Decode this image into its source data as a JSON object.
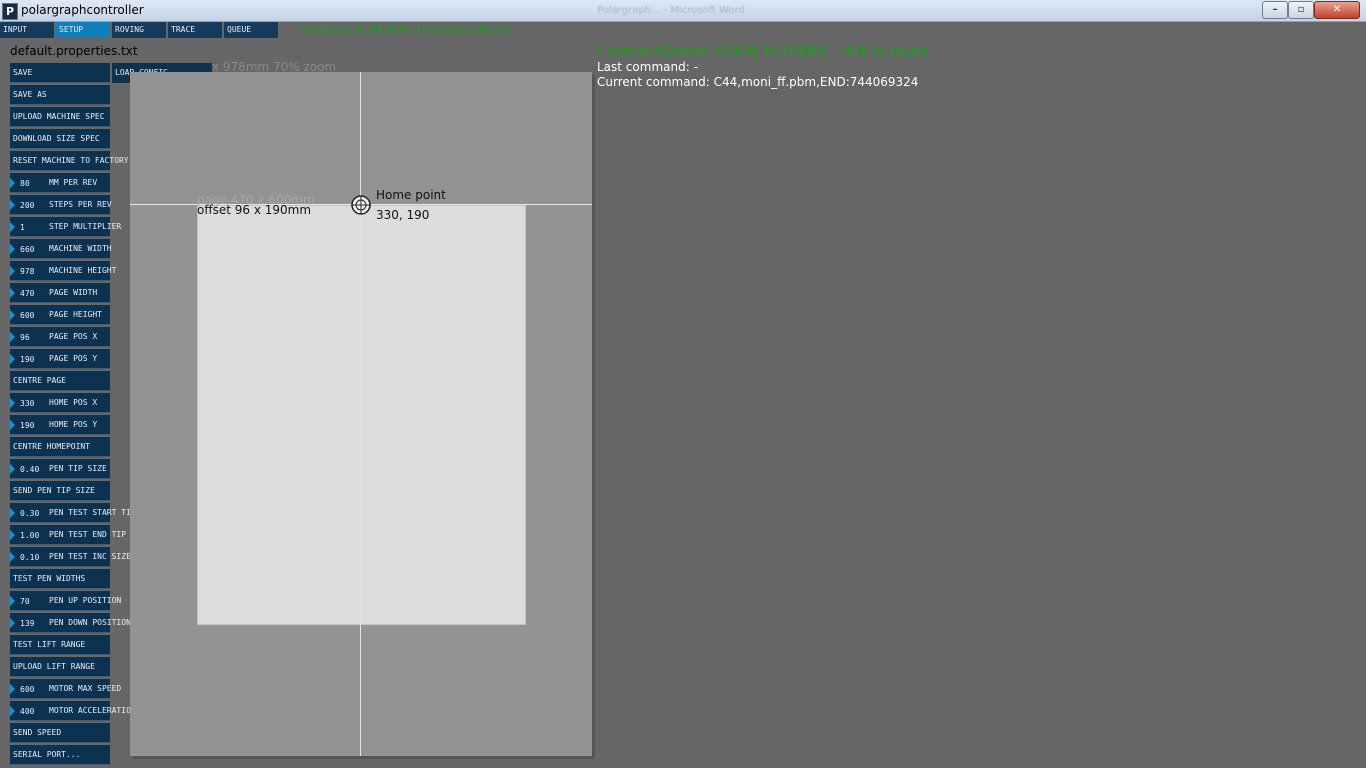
{
  "window": {
    "title": "polargraphcontroller",
    "icon_letter": "P",
    "background_title": "Polargraph... - Microsoft Word"
  },
  "tabs": [
    {
      "label": "INPUT",
      "active": false
    },
    {
      "label": "SETUP",
      "active": true
    },
    {
      "label": "ROVING",
      "active": false
    },
    {
      "label": "TRACE",
      "active": false
    },
    {
      "label": "QUEUE",
      "active": false
    }
  ],
  "status": {
    "ready": "Polargraph READY! (PolargraphSD)"
  },
  "panel": {
    "filename": "default.properties.txt",
    "load_config": "LOAD CONFIG",
    "controls": [
      {
        "type": "button",
        "label": "SAVE"
      },
      {
        "type": "button",
        "label": "SAVE AS"
      },
      {
        "type": "button",
        "label": "UPLOAD MACHINE SPEC"
      },
      {
        "type": "button",
        "label": "DOWNLOAD SIZE SPEC"
      },
      {
        "type": "button",
        "label": "RESET MACHINE TO FACTORY"
      },
      {
        "type": "number",
        "value": "80",
        "label": "MM PER REV"
      },
      {
        "type": "number",
        "value": "200",
        "label": "STEPS PER REV"
      },
      {
        "type": "number",
        "value": "1",
        "label": "STEP MULTIPLIER"
      },
      {
        "type": "number",
        "value": "660",
        "label": "MACHINE WIDTH"
      },
      {
        "type": "number",
        "value": "978",
        "label": "MACHINE HEIGHT"
      },
      {
        "type": "number",
        "value": "470",
        "label": "PAGE WIDTH"
      },
      {
        "type": "number",
        "value": "600",
        "label": "PAGE HEIGHT"
      },
      {
        "type": "number",
        "value": "96",
        "label": "PAGE POS X"
      },
      {
        "type": "number",
        "value": "190",
        "label": "PAGE POS Y"
      },
      {
        "type": "button",
        "label": "CENTRE PAGE"
      },
      {
        "type": "number",
        "value": "330",
        "label": "HOME POS X"
      },
      {
        "type": "number",
        "value": "190",
        "label": "HOME POS Y"
      },
      {
        "type": "button",
        "label": "CENTRE HOMEPOINT"
      },
      {
        "type": "number",
        "value": "0.40",
        "label": "PEN TIP SIZE"
      },
      {
        "type": "button",
        "label": "SEND PEN TIP SIZE"
      },
      {
        "type": "number",
        "value": "0.30",
        "label": "PEN TEST START TIP"
      },
      {
        "type": "number",
        "value": "1.00",
        "label": "PEN TEST END TIP"
      },
      {
        "type": "number",
        "value": "0.10",
        "label": "PEN TEST INC SIZE"
      },
      {
        "type": "button",
        "label": "TEST PEN WIDTHS"
      },
      {
        "type": "number",
        "value": "70",
        "label": "PEN UP POSITION"
      },
      {
        "type": "number",
        "value": "139",
        "label": "PEN DOWN POSITION"
      },
      {
        "type": "button",
        "label": "TEST LIFT RANGE"
      },
      {
        "type": "button",
        "label": "UPLOAD LIFT RANGE"
      },
      {
        "type": "number",
        "value": "600",
        "label": "MOTOR MAX SPEED"
      },
      {
        "type": "number",
        "value": "400",
        "label": "MOTOR ACCELERATION"
      },
      {
        "type": "button",
        "label": "SEND SPEED"
      },
      {
        "type": "button",
        "label": "SERIAL PORT..."
      }
    ]
  },
  "preview": {
    "machine_label": "x 978mm 70% zoom",
    "page_label": "page 470 x 600mm",
    "offset_label": "offset 96 x 190mm",
    "home_label": "Home point",
    "home_coords": "330, 190"
  },
  "queue": {
    "status": "CommandQueue: QUEUE RUNNING - click to pause",
    "last_command": "Last command: -",
    "current_command": "Current command: C44,moni_ff.pbm,END:744069324"
  },
  "colors": {
    "background": "#666666",
    "panel_button": "#0c3252",
    "active_tab": "#0e7fb8",
    "status_green": "#1ea01e"
  }
}
